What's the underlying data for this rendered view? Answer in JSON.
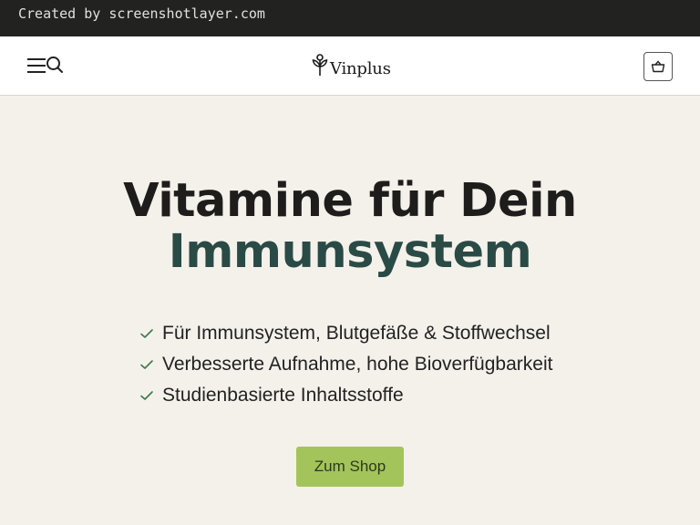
{
  "watermark": "Created by screenshotlayer.com",
  "header": {
    "brand": "Vinplus",
    "icons": {
      "menu": "hamburger-menu-icon",
      "search": "search-icon",
      "cart": "basket-icon",
      "logo": "sprout-logo-icon"
    }
  },
  "hero": {
    "headline_line1": "Vitamine für Dein",
    "headline_line2": "Immunsystem",
    "features": [
      "Für Immunsystem, Blutgefäße & Stoffwechsel",
      "Verbesserte Aufnahme, hohe Bioverfügbarkeit",
      "Studienbasierte Inhaltsstoffe"
    ],
    "cta_label": "Zum Shop"
  },
  "colors": {
    "background": "#f4f1eb",
    "accent_text": "#2a4a46",
    "cta": "#a3c45a",
    "check": "#3a7a4a"
  }
}
